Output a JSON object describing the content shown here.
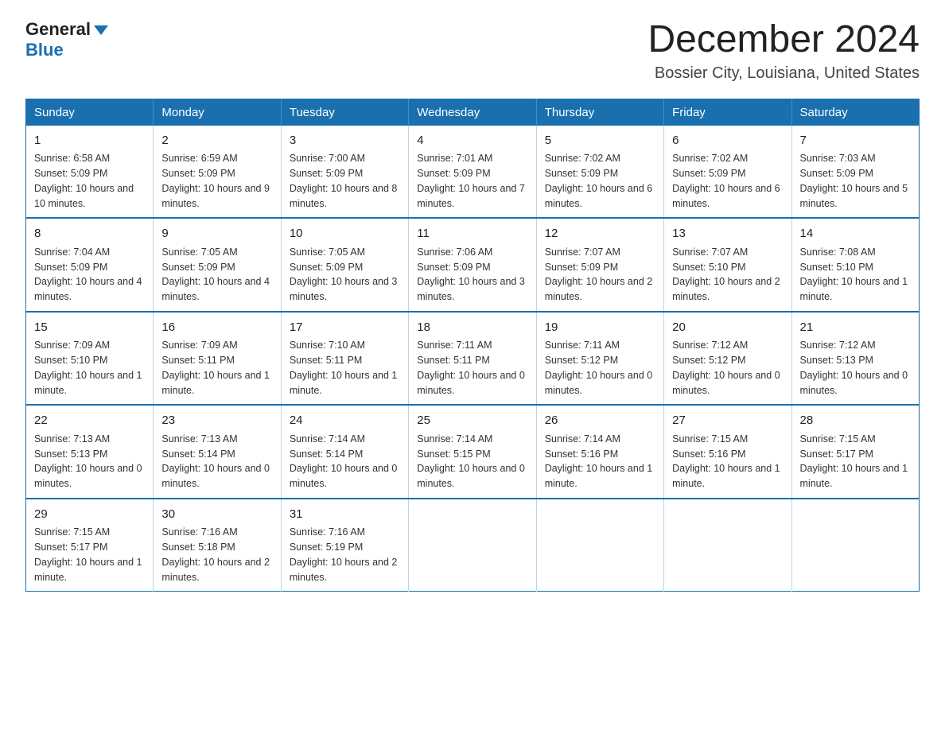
{
  "header": {
    "logo_general": "General",
    "logo_blue": "Blue",
    "month_title": "December 2024",
    "location": "Bossier City, Louisiana, United States"
  },
  "weekdays": [
    "Sunday",
    "Monday",
    "Tuesday",
    "Wednesday",
    "Thursday",
    "Friday",
    "Saturday"
  ],
  "weeks": [
    [
      {
        "day": "1",
        "sunrise": "6:58 AM",
        "sunset": "5:09 PM",
        "daylight": "10 hours and 10 minutes."
      },
      {
        "day": "2",
        "sunrise": "6:59 AM",
        "sunset": "5:09 PM",
        "daylight": "10 hours and 9 minutes."
      },
      {
        "day": "3",
        "sunrise": "7:00 AM",
        "sunset": "5:09 PM",
        "daylight": "10 hours and 8 minutes."
      },
      {
        "day": "4",
        "sunrise": "7:01 AM",
        "sunset": "5:09 PM",
        "daylight": "10 hours and 7 minutes."
      },
      {
        "day": "5",
        "sunrise": "7:02 AM",
        "sunset": "5:09 PM",
        "daylight": "10 hours and 6 minutes."
      },
      {
        "day": "6",
        "sunrise": "7:02 AM",
        "sunset": "5:09 PM",
        "daylight": "10 hours and 6 minutes."
      },
      {
        "day": "7",
        "sunrise": "7:03 AM",
        "sunset": "5:09 PM",
        "daylight": "10 hours and 5 minutes."
      }
    ],
    [
      {
        "day": "8",
        "sunrise": "7:04 AM",
        "sunset": "5:09 PM",
        "daylight": "10 hours and 4 minutes."
      },
      {
        "day": "9",
        "sunrise": "7:05 AM",
        "sunset": "5:09 PM",
        "daylight": "10 hours and 4 minutes."
      },
      {
        "day": "10",
        "sunrise": "7:05 AM",
        "sunset": "5:09 PM",
        "daylight": "10 hours and 3 minutes."
      },
      {
        "day": "11",
        "sunrise": "7:06 AM",
        "sunset": "5:09 PM",
        "daylight": "10 hours and 3 minutes."
      },
      {
        "day": "12",
        "sunrise": "7:07 AM",
        "sunset": "5:09 PM",
        "daylight": "10 hours and 2 minutes."
      },
      {
        "day": "13",
        "sunrise": "7:07 AM",
        "sunset": "5:10 PM",
        "daylight": "10 hours and 2 minutes."
      },
      {
        "day": "14",
        "sunrise": "7:08 AM",
        "sunset": "5:10 PM",
        "daylight": "10 hours and 1 minute."
      }
    ],
    [
      {
        "day": "15",
        "sunrise": "7:09 AM",
        "sunset": "5:10 PM",
        "daylight": "10 hours and 1 minute."
      },
      {
        "day": "16",
        "sunrise": "7:09 AM",
        "sunset": "5:11 PM",
        "daylight": "10 hours and 1 minute."
      },
      {
        "day": "17",
        "sunrise": "7:10 AM",
        "sunset": "5:11 PM",
        "daylight": "10 hours and 1 minute."
      },
      {
        "day": "18",
        "sunrise": "7:11 AM",
        "sunset": "5:11 PM",
        "daylight": "10 hours and 0 minutes."
      },
      {
        "day": "19",
        "sunrise": "7:11 AM",
        "sunset": "5:12 PM",
        "daylight": "10 hours and 0 minutes."
      },
      {
        "day": "20",
        "sunrise": "7:12 AM",
        "sunset": "5:12 PM",
        "daylight": "10 hours and 0 minutes."
      },
      {
        "day": "21",
        "sunrise": "7:12 AM",
        "sunset": "5:13 PM",
        "daylight": "10 hours and 0 minutes."
      }
    ],
    [
      {
        "day": "22",
        "sunrise": "7:13 AM",
        "sunset": "5:13 PM",
        "daylight": "10 hours and 0 minutes."
      },
      {
        "day": "23",
        "sunrise": "7:13 AM",
        "sunset": "5:14 PM",
        "daylight": "10 hours and 0 minutes."
      },
      {
        "day": "24",
        "sunrise": "7:14 AM",
        "sunset": "5:14 PM",
        "daylight": "10 hours and 0 minutes."
      },
      {
        "day": "25",
        "sunrise": "7:14 AM",
        "sunset": "5:15 PM",
        "daylight": "10 hours and 0 minutes."
      },
      {
        "day": "26",
        "sunrise": "7:14 AM",
        "sunset": "5:16 PM",
        "daylight": "10 hours and 1 minute."
      },
      {
        "day": "27",
        "sunrise": "7:15 AM",
        "sunset": "5:16 PM",
        "daylight": "10 hours and 1 minute."
      },
      {
        "day": "28",
        "sunrise": "7:15 AM",
        "sunset": "5:17 PM",
        "daylight": "10 hours and 1 minute."
      }
    ],
    [
      {
        "day": "29",
        "sunrise": "7:15 AM",
        "sunset": "5:17 PM",
        "daylight": "10 hours and 1 minute."
      },
      {
        "day": "30",
        "sunrise": "7:16 AM",
        "sunset": "5:18 PM",
        "daylight": "10 hours and 2 minutes."
      },
      {
        "day": "31",
        "sunrise": "7:16 AM",
        "sunset": "5:19 PM",
        "daylight": "10 hours and 2 minutes."
      },
      null,
      null,
      null,
      null
    ]
  ]
}
